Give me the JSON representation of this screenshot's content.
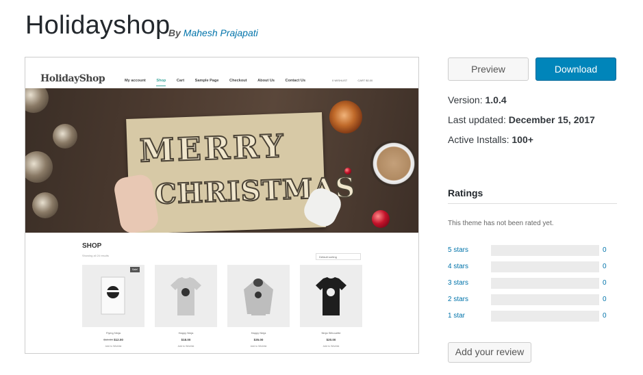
{
  "theme": {
    "title": "Holidayshop",
    "by_prefix": "By",
    "author": "Mahesh Prajapati"
  },
  "screenshot": {
    "logo": "HolidayShop",
    "menu": [
      "My account",
      "Shop",
      "Cart",
      "Sample Page",
      "Checkout",
      "About Us",
      "Contact Us"
    ],
    "active_menu": "Shop",
    "mini_right": [
      "0 WISHLIST",
      "CART $0.00"
    ],
    "hero": {
      "line1": "MERRY",
      "line2": "CHRISTMAS"
    },
    "shop": {
      "title": "SHOP",
      "subtitle": "Showing all 24 results",
      "sort": "Default sorting",
      "products": [
        {
          "name": "Flying Ninja",
          "old_price": "$15.00",
          "price": "$12.00",
          "wish": "Add to Wishlist",
          "sale": "Sale!"
        },
        {
          "name": "Happy Ninja",
          "price": "$18.00",
          "wish": "Add to Wishlist"
        },
        {
          "name": "Happy Ninja",
          "price": "$35.00",
          "wish": "Add to Wishlist"
        },
        {
          "name": "Ninja Silhouette",
          "price": "$20.00",
          "wish": "Add to Wishlist"
        }
      ]
    }
  },
  "actions": {
    "preview": "Preview",
    "download": "Download",
    "review": "Add your review"
  },
  "meta": {
    "version_label": "Version:",
    "version": "1.0.4",
    "updated_label": "Last updated:",
    "updated": "December 15, 2017",
    "installs_label": "Active Installs:",
    "installs": "100+"
  },
  "ratings": {
    "title": "Ratings",
    "not_rated": "This theme has not been rated yet.",
    "rows": [
      {
        "label": "5 stars",
        "count": "0",
        "fraction": 0
      },
      {
        "label": "4 stars",
        "count": "0",
        "fraction": 0
      },
      {
        "label": "3 stars",
        "count": "0",
        "fraction": 0
      },
      {
        "label": "2 stars",
        "count": "0",
        "fraction": 0
      },
      {
        "label": "1 star",
        "count": "0",
        "fraction": 0
      }
    ]
  },
  "colors": {
    "primary": "#0085ba",
    "link": "#0073aa",
    "accent_teal": "#3aa59a"
  }
}
